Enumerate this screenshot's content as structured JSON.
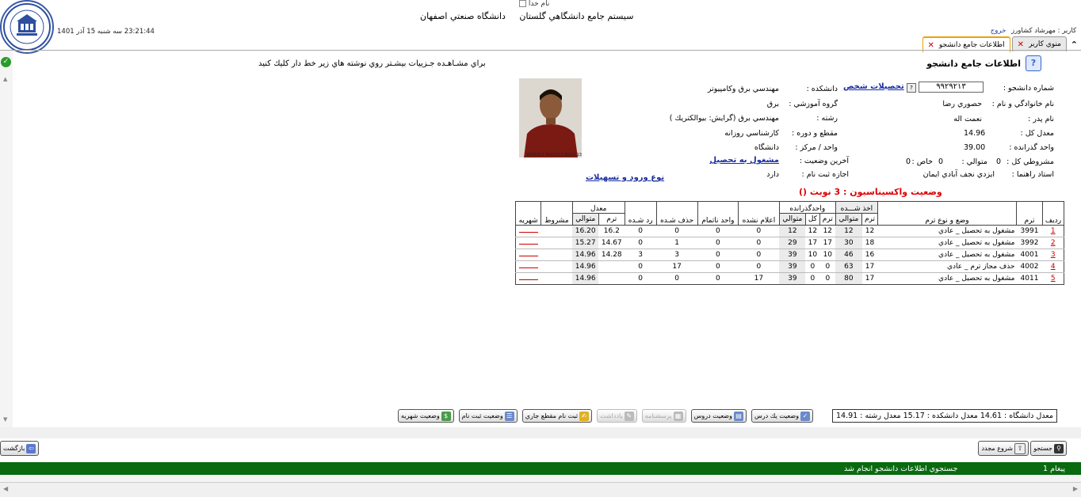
{
  "header": {
    "broken_image_alt": "نام خدا",
    "system_title": "سيستم جامع دانشگاهي گلستان",
    "university": "دانشگاه صنعتي اصفهان",
    "datetime": "23:21:44 سه شنبه 15 آذر 1401",
    "user_label": "كاربر : مهرشاد كشاورز",
    "logout": "خروج"
  },
  "tabs": [
    {
      "label": "منوي كاربر",
      "active": false
    },
    {
      "label": "اطلاعات جامع دانشجو",
      "active": true
    }
  ],
  "page": {
    "title": "اطلاعات جامع دانشجو",
    "hint": "براي مشـاهـده جـزييات بيشـتر روي نوشته هاي زير خط دار كليك كنيد",
    "photo_caption": "9929213 9929213 9929213"
  },
  "student": {
    "id_label": "شماره دانشجو :",
    "id_value": "۹۹۲۹۲۱۳",
    "personal_link": "تحصيلات شخص",
    "name_label": "نام خانوادگي و نام :",
    "name_value": "حصوري  رضا",
    "father_label": "نام پدر :",
    "father_value": "نعمت اله",
    "gpa_label": "معدل كل :",
    "gpa_value": "14.96",
    "passed_label": "واحد گذرانده :",
    "passed_value": "39.00",
    "probation_label": "مشروطي كل :",
    "probation_total": "0",
    "probation_consec_label": "متوالي :",
    "probation_consec": "0",
    "probation_special_label": "خاص :",
    "probation_special": "0",
    "advisor_label": "استاد راهنما :",
    "advisor_value": "ايزدي نجف آبادي ايمان",
    "faculty_label": "دانشكده :",
    "faculty_value": "مهندسي برق وكامپيوتر",
    "group_label": "گروه آموزشي :",
    "group_value": "برق",
    "major_label": "رشته :",
    "major_value": "مهندسي برق (گرايش: بيوالكتريك )",
    "level_label": "مقطع و دوره :",
    "level_value": "كارشناسي   روزانه",
    "campus_label": "واحد / مركز :",
    "campus_value": "دانشگاه",
    "last_status_label": "آخرين وضعيت :",
    "last_status_value": "مشغول به تحصيل",
    "reg_label": "اجازه ثبت نام :",
    "reg_value": "دارد",
    "entry_link": "نوع ورود و تسهيلات",
    "vaccine": "وضعيت واكسيناسيون : 3 نوبت ()"
  },
  "table": {
    "headers": {
      "row": "رديف",
      "term": "ترم",
      "status": "وضع و نوع ترم",
      "taken": "اخذ شـــده",
      "taken_term": "ترم",
      "taken_consec": "متوالي",
      "passed": "واحدگذرانده",
      "passed_term": "ترم",
      "passed_total": "كل",
      "passed_consec": "متوالي",
      "announced": "اعلام نشده",
      "incomplete": "واحد ناتمام",
      "deleted": "حذف شـده",
      "failed": "رد شـده",
      "gpa": "معدل",
      "gpa_term": "ترم",
      "gpa_consec": "متوالي",
      "probation": "مشروط",
      "tuition": "شهريه"
    },
    "rows": [
      {
        "idx": "1",
        "term": "3991",
        "status": "مشغول به تحصيل _ عادي",
        "t_term": "12",
        "t_consec": "12",
        "p_term": "12",
        "p_total": "12",
        "p_consec": "12",
        "announced": "0",
        "incomplete": "0",
        "deleted": "0",
        "failed": "0",
        "g_term": "16.2",
        "g_consec": "16.20",
        "probation": ""
      },
      {
        "idx": "2",
        "term": "3992",
        "status": "مشغول به تحصيل _ عادي",
        "t_term": "18",
        "t_consec": "30",
        "p_term": "17",
        "p_total": "17",
        "p_consec": "29",
        "announced": "0",
        "incomplete": "0",
        "deleted": "1",
        "failed": "0",
        "g_term": "14.67",
        "g_consec": "15.27",
        "probation": ""
      },
      {
        "idx": "3",
        "term": "4001",
        "status": "مشغول به تحصيل _ عادي",
        "t_term": "16",
        "t_consec": "46",
        "p_term": "10",
        "p_total": "10",
        "p_consec": "39",
        "announced": "0",
        "incomplete": "0",
        "deleted": "3",
        "failed": "3",
        "g_term": "14.28",
        "g_consec": "14.96",
        "probation": ""
      },
      {
        "idx": "4",
        "term": "4002",
        "status": "حذف مجاز ترم _ عادي",
        "t_term": "17",
        "t_consec": "63",
        "p_term": "0",
        "p_total": "0",
        "p_consec": "39",
        "announced": "0",
        "incomplete": "0",
        "deleted": "17",
        "failed": "0",
        "g_term": "",
        "g_consec": "14.96",
        "probation": ""
      },
      {
        "idx": "5",
        "term": "4011",
        "status": "مشغول به تحصيل _ عادي",
        "t_term": "17",
        "t_consec": "80",
        "p_term": "0",
        "p_total": "0",
        "p_consec": "39",
        "announced": "17",
        "incomplete": "0",
        "deleted": "0",
        "failed": "0",
        "g_term": "",
        "g_consec": "14.96",
        "probation": ""
      }
    ]
  },
  "averages": {
    "university": "معدل دانشگاه :  14.61",
    "faculty": "معدل دانشكده :  15.17",
    "major": "معدل رشته :  14.91"
  },
  "buttons": {
    "course_status": "وضعيت يك درس",
    "courses_status": "وضعيت دروس",
    "questionnaire": "پرسشنامه",
    "note": "يادداشت",
    "reg_registered": "ثبت نام مقطع جاري",
    "reg_status": "وضعيت ثبت نام",
    "tuition_status": "وضعيت شهريه",
    "search": "جستجو",
    "new_start": "شروع مجدد",
    "back": "بازگشت"
  },
  "message": {
    "count": "1 پيغام",
    "text": "جستجوي اطلاعات دانشجو انجام شد"
  }
}
